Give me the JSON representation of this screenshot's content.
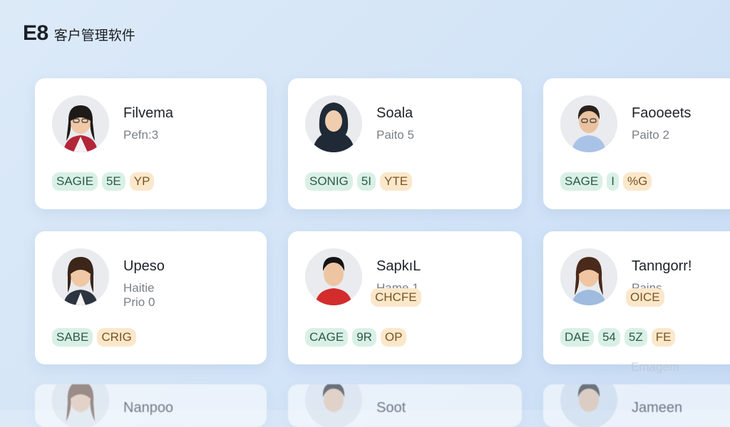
{
  "app": {
    "brand": "E8",
    "product": "客户管理软件"
  },
  "cards": [
    {
      "name": "Filvema",
      "meta": "Pefn:3",
      "tags": [
        "SAGIE",
        "5E",
        "YP"
      ],
      "tag_colors": [
        "green",
        "green",
        "orange"
      ]
    },
    {
      "name": "Soala",
      "meta": "Paito 5",
      "tags": [
        "SONIG",
        "5I",
        "YTE"
      ],
      "tag_colors": [
        "green",
        "green",
        "orange"
      ]
    },
    {
      "name": "Faooeets",
      "meta": "Paito 2",
      "tags": [
        "SAGE",
        "I"
      ],
      "tag_colors": [
        "green",
        "green",
        "orange"
      ]
    },
    {
      "name": "Upeso",
      "meta": "Haitie",
      "meta2": "Prio 0",
      "tags": [
        "SABE",
        "CRIG"
      ],
      "tag_colors": [
        "green",
        "orange"
      ]
    },
    {
      "name": "SapkıL",
      "meta": "Hame 1",
      "inline_tag": "CHCFE",
      "tags": [
        "CAGE",
        "9R",
        "OP"
      ],
      "tag_colors": [
        "green",
        "green",
        "orange"
      ]
    },
    {
      "name": "Tanngorr!",
      "meta": "Pains",
      "inline_tag": "OICE",
      "tags": [
        "DAE",
        "54",
        "5Z",
        "FE"
      ],
      "tag_colors": [
        "green",
        "green",
        "green",
        "orange"
      ]
    },
    {
      "name": "Nanpoo"
    },
    {
      "name": "Soot"
    },
    {
      "name": "Jameen"
    }
  ],
  "partial_header": "Emagem",
  "colors": {
    "card_bg": "#ffffff",
    "tag_green": "#d9f0e6",
    "tag_orange": "#fbe8cb",
    "page_bg": "#d3e4f7"
  }
}
